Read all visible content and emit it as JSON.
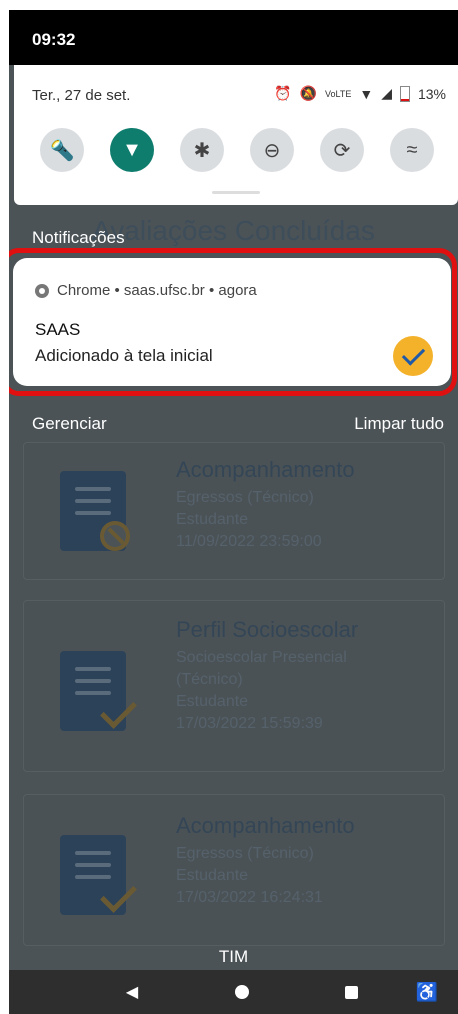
{
  "status_bar": {
    "time": "09:32"
  },
  "quick_settings": {
    "date": "Ter., 27 de set.",
    "battery": "13%",
    "network_badge": "VoLTE",
    "tiles": [
      {
        "icon": "flashlight-icon",
        "glyph": "🔦",
        "on": false
      },
      {
        "icon": "wifi-icon",
        "glyph": "▼",
        "on": true
      },
      {
        "icon": "bluetooth-icon",
        "glyph": "✱",
        "on": false
      },
      {
        "icon": "do-not-disturb-icon",
        "glyph": "⊖",
        "on": false
      },
      {
        "icon": "auto-rotate-icon",
        "glyph": "⟳",
        "on": false
      },
      {
        "icon": "data-saver-icon",
        "glyph": "≈",
        "on": false
      }
    ]
  },
  "background_page": {
    "title": "Avaliações Concluídas",
    "cards": [
      {
        "title": "Acompanhamento",
        "lines": [
          "Egressos (Técnico)",
          "Estudante",
          "11/09/2022 23:59:00"
        ],
        "status": "blocked"
      },
      {
        "title": "Perfil Socioescolar",
        "lines": [
          "Socioescolar Presencial",
          "(Técnico)",
          "Estudante",
          "17/03/2022 15:59:39"
        ],
        "status": "done"
      },
      {
        "title": "Acompanhamento",
        "lines": [
          "Egressos (Técnico)",
          "Estudante",
          "17/03/2022 16:24:31"
        ],
        "status": "done"
      }
    ]
  },
  "notifications": {
    "header": "Notificações",
    "items": [
      {
        "app": "Chrome • saas.ufsc.br • agora",
        "title": "SAAS",
        "text": "Adicionado à tela inicial"
      }
    ],
    "manage_label": "Gerenciar",
    "clear_label": "Limpar tudo"
  },
  "carrier": "TIM",
  "colors": {
    "accent_tile": "#0f7d6e",
    "highlight_outline": "#e01010",
    "badge": "#f4b12a"
  }
}
